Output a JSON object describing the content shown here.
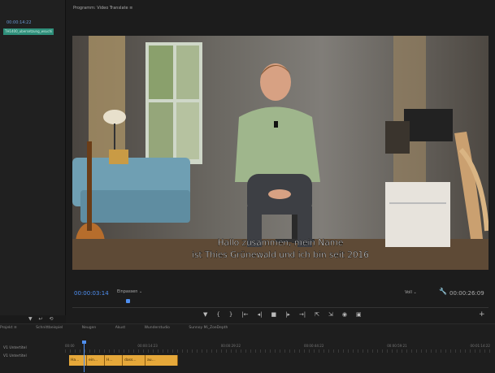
{
  "left_panel": {
    "timecode": "00:00:14:22",
    "clip_name": "TH1400_ubersetzung_wsuchi",
    "tools": "▼ ↩ ⟲"
  },
  "monitor": {
    "title": "Programm: Video Translate ≡",
    "subtitle_line1": "Hallo zusammen, mein Name",
    "subtitle_line2": "ist Thies Grünewald und ich bin seit 2016",
    "current_timecode": "00:00:03:14",
    "fit_label": "Einpassen",
    "quality_label": "Voll",
    "duration_timecode": "00:00:26:09"
  },
  "transport": {
    "marker": "▼",
    "in_point": "{",
    "out_point": "}",
    "go_to_in": "|←",
    "step_back": "◂|",
    "play": "■",
    "step_forward": "|▸",
    "go_to_out": "→|",
    "lift": "⇱",
    "extract": "⇲",
    "export_frame": "◉",
    "compare": "▣",
    "add": "+"
  },
  "timeline": {
    "tabs": [
      "Projekt ≡",
      "Schnittbeispiel",
      "Neugen",
      "Akust",
      "Wunderstudio",
      "Sunnoy Mi_ZoeDepth"
    ],
    "timecodes": [
      "00:00",
      "00:00:14:23",
      "00:00:29:22",
      "00:00:44:22",
      "00:00:59:21",
      "00:01:14:22"
    ],
    "track_labels": [
      "V1  Untertitel",
      "V1  Untertitel"
    ],
    "clips": [
      "Ha...",
      "ein...",
      "H...",
      "dass...",
      "au..."
    ]
  }
}
